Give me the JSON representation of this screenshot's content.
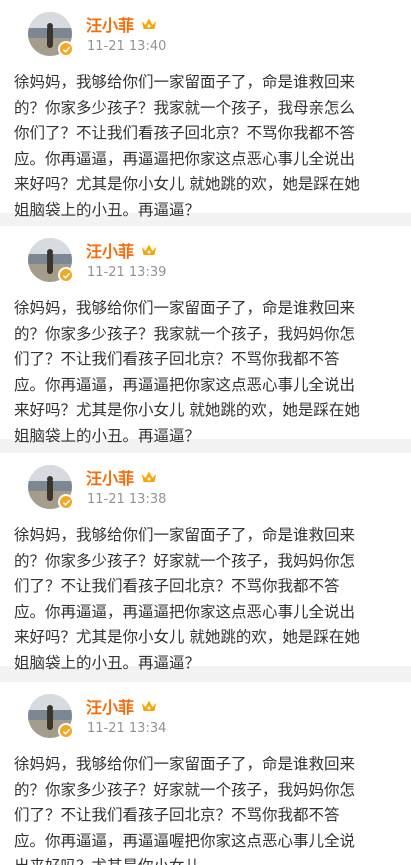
{
  "posts": [
    {
      "username": "汪小菲",
      "timestamp": "11-21 13:40",
      "lines": [
        "徐妈妈，我够给你们一家留面子了，命是谁救回来",
        "的？你家多少孩子？我家就一个孩子，我母亲怎么",
        "你们了？不让我们看孩子回北京？不骂你我都不答",
        "应。你再逼逼，再逼逼把你家这点恶心事儿全说出",
        "来好吗？尤其是你小女儿 就她跳的欢，她是踩在她",
        "姐脑袋上的小丑。再逼逼？"
      ]
    },
    {
      "username": "汪小菲",
      "timestamp": "11-21 13:39",
      "lines": [
        "徐妈妈，我够给你们一家留面子了，命是谁救回来",
        "的？你家多少孩子？我家就一个孩子，我妈妈你怎",
        "们了？不让我们看孩子回北京？不骂你我都不答",
        "应。你再逼逼，再逼逼把你家这点恶心事儿全说出",
        "来好吗？尤其是你小女儿 就她跳的欢，她是踩在她",
        "姐脑袋上的小丑。再逼逼？"
      ]
    },
    {
      "username": "汪小菲",
      "timestamp": "11-21 13:38",
      "lines": [
        "徐妈妈，我够给你们一家留面子了，命是谁救回来",
        "的？你家多少孩子？好家就一个孩子，我妈妈你怎",
        "们了？不让我们看孩子回北京？不骂你我都不答",
        "应。你再逼逼，再逼逼把你家这点恶心事儿全说出",
        "来好吗？尤其是你小女儿 就她跳的欢，她是踩在她",
        "姐脑袋上的小丑。再逼逼？"
      ]
    },
    {
      "username": "汪小菲",
      "timestamp": "11-21 13:34",
      "lines": [
        "徐妈妈，我够给你们一家留面子了，命是谁救回来",
        "的？你家多少孩子？好家就一个孩子，我妈妈你怎",
        "们了？不让我们看孩子回北京？不骂你我都不答",
        "应。你再逼逼，再逼逼喔把你家这点恶心事儿全说",
        "出来好吗？尤其是你小女儿"
      ]
    }
  ]
}
